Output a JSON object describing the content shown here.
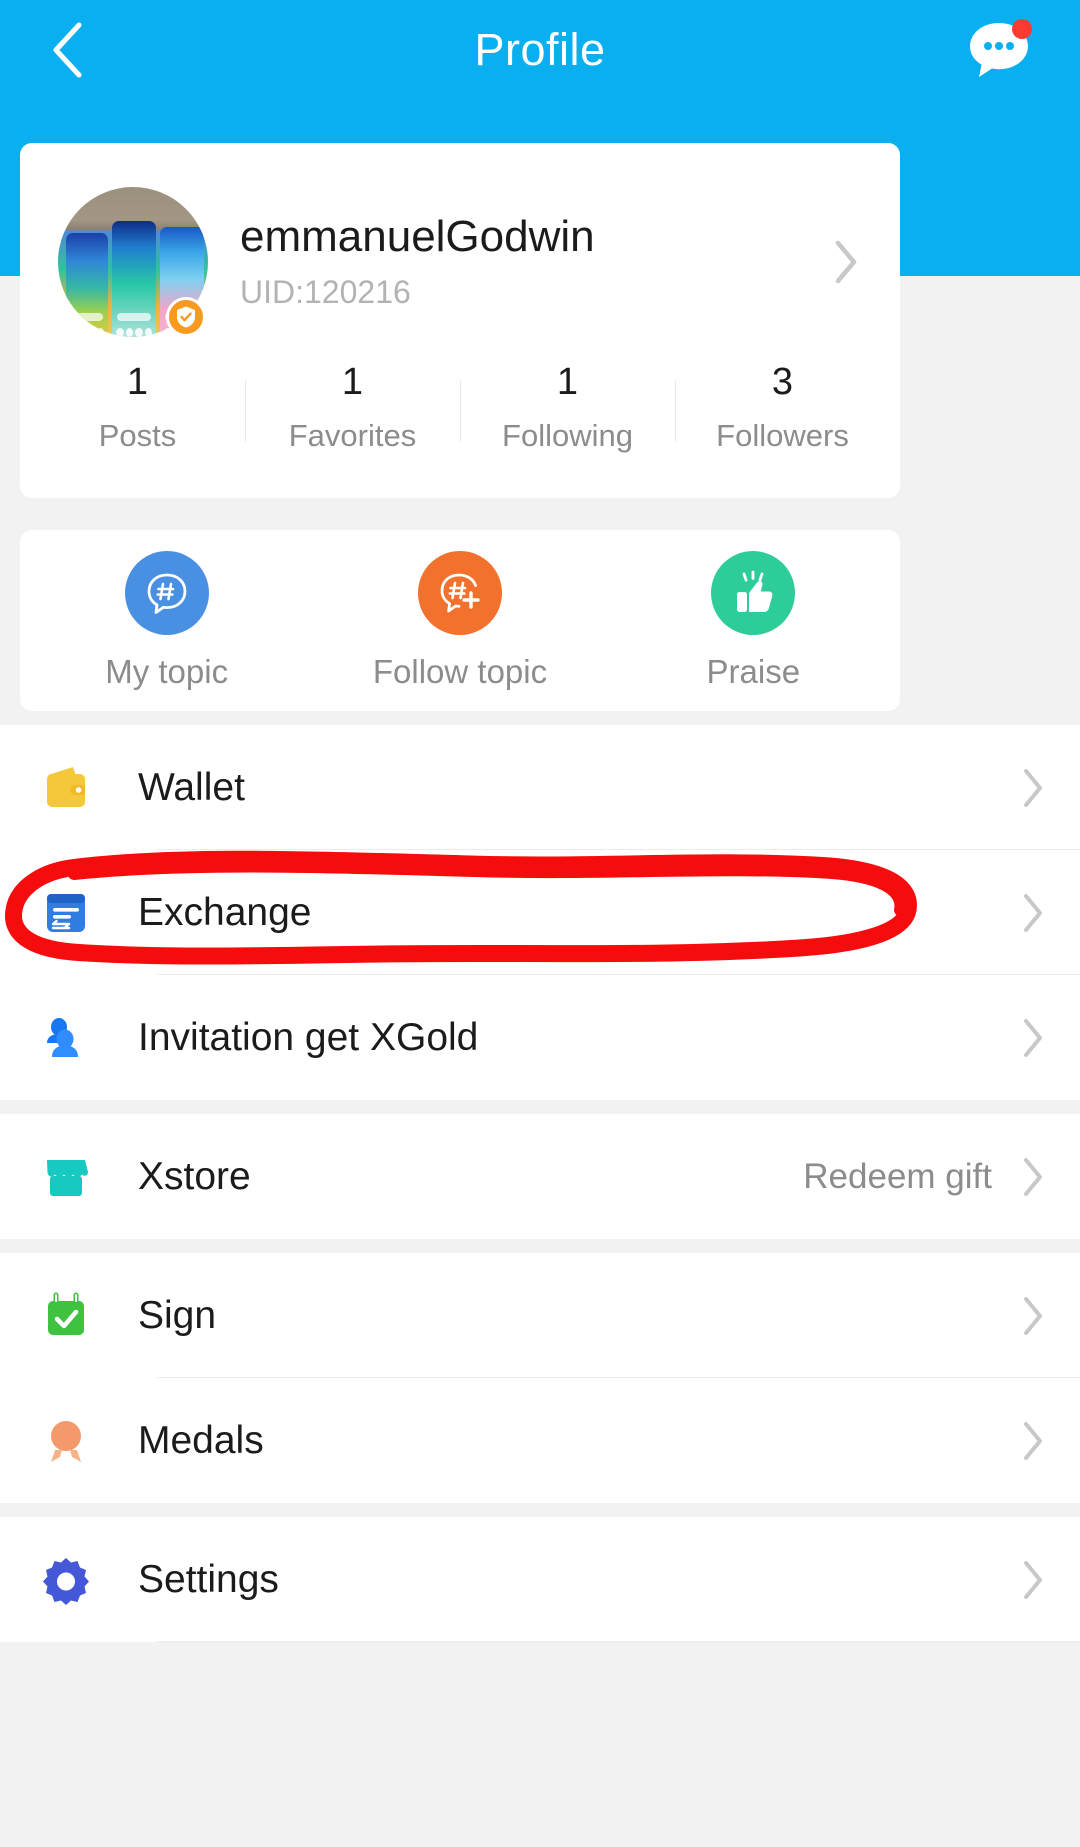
{
  "header": {
    "title": "Profile",
    "back_icon": "chevron-left-icon",
    "message_icon": "chat-bubble-icon",
    "has_unread_badge": true,
    "bg_color": "#0aaff0"
  },
  "profile": {
    "name": "emmanuelGodwin",
    "uid": "UID:120216",
    "avatar_alt": "three-smartphones-photo",
    "verified_badge": "shield-check-icon",
    "chevron": "chevron-right-icon",
    "stats": [
      {
        "value": "1",
        "label": "Posts"
      },
      {
        "value": "1",
        "label": "Favorites"
      },
      {
        "value": "1",
        "label": "Following"
      },
      {
        "value": "3",
        "label": "Followers"
      }
    ]
  },
  "actions": [
    {
      "label": "My topic",
      "icon": "hashtag-bubble-icon",
      "color": "#4a90e2"
    },
    {
      "label": "Follow topic",
      "icon": "hashtag-bubble-plus-icon",
      "color": "#f2712c"
    },
    {
      "label": "Praise",
      "icon": "thumbs-up-icon",
      "color": "#2ecc9b"
    }
  ],
  "menu_groups": [
    {
      "items": [
        {
          "label": "Wallet",
          "icon": "wallet-icon",
          "color": "#f5c73b",
          "value": "",
          "highlighted": false
        },
        {
          "label": "Exchange",
          "icon": "exchange-icon",
          "color": "#2f7de1",
          "value": "",
          "highlighted": true
        },
        {
          "label": "Invitation get XGold",
          "icon": "people-icon",
          "color": "#1877f2",
          "value": "",
          "highlighted": false
        }
      ]
    },
    {
      "items": [
        {
          "label": "Xstore",
          "icon": "storefront-icon",
          "color": "#18c9c2",
          "value": "Redeem gift",
          "highlighted": false
        }
      ]
    },
    {
      "items": [
        {
          "label": "Sign",
          "icon": "calendar-check-icon",
          "color": "#3fc23f",
          "value": "",
          "highlighted": false
        },
        {
          "label": "Medals",
          "icon": "medal-icon",
          "color": "#f49a6a",
          "value": "",
          "highlighted": false
        }
      ]
    },
    {
      "items": [
        {
          "label": "Settings",
          "icon": "gear-icon",
          "color": "#4458d8",
          "value": "",
          "highlighted": false
        }
      ]
    }
  ],
  "annotation": {
    "type": "hand-drawn-red-ellipse",
    "color": "#f50d0d",
    "target": "Exchange"
  }
}
